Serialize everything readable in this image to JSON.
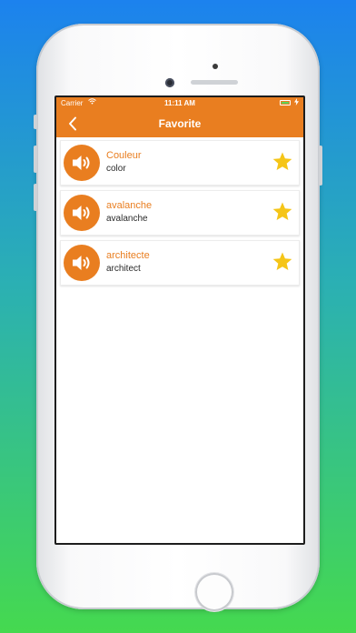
{
  "status_bar": {
    "carrier": "Carrier",
    "time": "11:11 AM"
  },
  "nav": {
    "title": "Favorite"
  },
  "items": [
    {
      "word": "Couleur",
      "translation": "color"
    },
    {
      "word": "avalanche",
      "translation": "avalanche"
    },
    {
      "word": "architecte",
      "translation": "architect"
    }
  ],
  "colors": {
    "accent": "#e97e20",
    "star": "#f5c518",
    "battery": "#5bd45a"
  },
  "icons": {
    "back": "chevron-left-icon",
    "speaker": "speaker-icon",
    "star": "star-icon",
    "wifi": "wifi-icon",
    "battery": "battery-icon"
  }
}
